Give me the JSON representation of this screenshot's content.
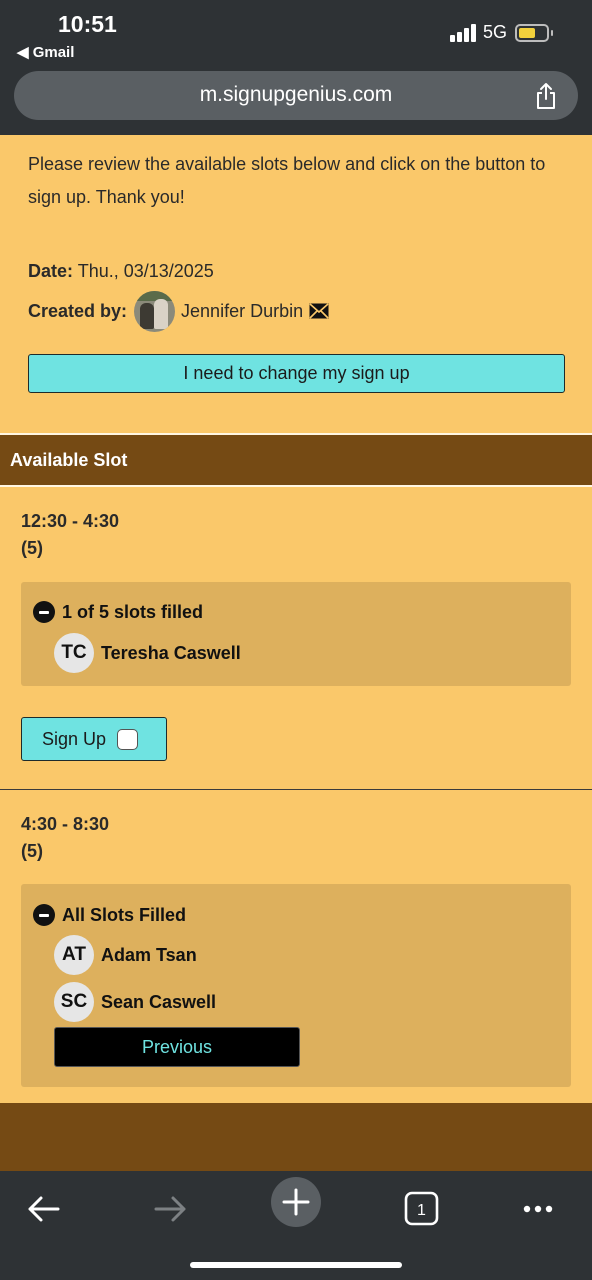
{
  "status_bar": {
    "time": "10:51",
    "back_app": "◀ Gmail",
    "network": "5G"
  },
  "browser": {
    "url": "m.signupgenius.com"
  },
  "page": {
    "intro": "Please review the available slots below and click on the button to sign up. Thank you!",
    "date_label": "Date:",
    "date_value": "Thu., 03/13/2025",
    "creator_label": "Created by:",
    "creator_name": "Jennifer Durbin",
    "change_button": "I need to change my sign up",
    "section_header": "Available Slot",
    "footer_color": "#754a14"
  },
  "slots": [
    {
      "time": "12:30 - 4:30",
      "count": "(5)",
      "status": "1 of 5 slots filled",
      "people": [
        {
          "initials": "TC",
          "name": "Teresha Caswell"
        }
      ],
      "signup_label": "Sign Up"
    },
    {
      "time": "4:30 - 8:30",
      "count": "(5)",
      "status": "All Slots Filled",
      "people": [
        {
          "initials": "AT",
          "name": "Adam Tsan"
        },
        {
          "initials": "SC",
          "name": "Sean Caswell"
        }
      ],
      "previous_label": "Previous"
    }
  ],
  "colors": {
    "page_bg": "#fac86a",
    "brown": "#754a14",
    "accent_cyan": "#6fe3e1",
    "slot_box": "#ddb05d"
  }
}
